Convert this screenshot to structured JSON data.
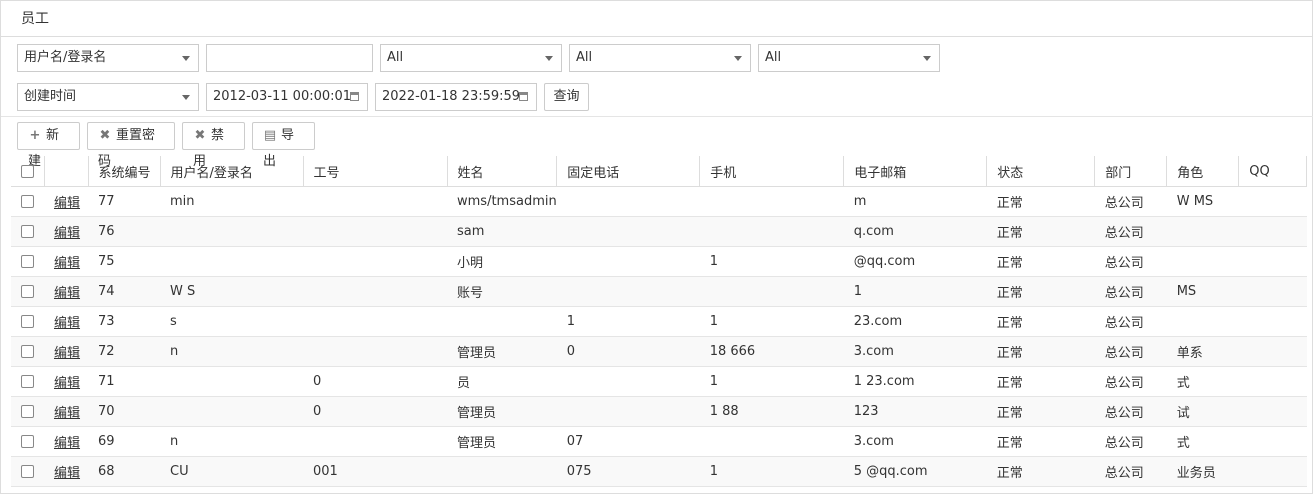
{
  "panel": {
    "title": "员工"
  },
  "filters": {
    "field_select": "用户名/登录名",
    "keyword_value": "",
    "select1": "All",
    "select2": "All",
    "select3": "All",
    "time_field_select": "创建时间",
    "start_time": "2012-03-11 00:00:01",
    "end_time": "2022-01-18 23:59:59",
    "query_label": "查询"
  },
  "toolbar": {
    "new_label": "新建",
    "reset_password_label": "重置密码",
    "disable_label": "禁用",
    "export_label": "导出"
  },
  "table": {
    "edit_label": "编辑",
    "columns": [
      "系统编号",
      "用户名/登录名",
      "工号",
      "姓名",
      "固定电话",
      "手机",
      "电子邮箱",
      "状态",
      "部门",
      "角色",
      "QQ"
    ],
    "rows": [
      {
        "id": "77",
        "username": "min",
        "empno": "",
        "name": "wms/tmsadmin",
        "phone": "",
        "mobile": "",
        "email": "m",
        "status": "正常",
        "dept": "总公司",
        "role": "W MS"
      },
      {
        "id": "76",
        "username": "",
        "empno": "",
        "name": "sam",
        "phone": "",
        "mobile": "",
        "email": "q.com",
        "status": "正常",
        "dept": "总公司",
        "role": ""
      },
      {
        "id": "75",
        "username": "",
        "empno": "",
        "name": "小明",
        "phone": "",
        "mobile": "1",
        "email": "@qq.com",
        "status": "正常",
        "dept": "总公司",
        "role": ""
      },
      {
        "id": "74",
        "username": "W S",
        "empno": "",
        "name": "账号",
        "phone": "",
        "mobile": "",
        "email": "1",
        "status": "正常",
        "dept": "总公司",
        "role": "MS"
      },
      {
        "id": "73",
        "username": "s",
        "empno": "",
        "name": "",
        "phone": "1",
        "mobile": "1",
        "email": "23.com",
        "status": "正常",
        "dept": "总公司",
        "role": ""
      },
      {
        "id": "72",
        "username": "n",
        "empno": "",
        "name": "管理员",
        "phone": "0",
        "mobile": "18 666",
        "email": "3.com",
        "status": "正常",
        "dept": "总公司",
        "role": "单系"
      },
      {
        "id": "71",
        "username": "",
        "empno": "0",
        "name": "员",
        "phone": "",
        "mobile": "1",
        "email": "1 23.com",
        "status": "正常",
        "dept": "总公司",
        "role": "式"
      },
      {
        "id": "70",
        "username": "",
        "empno": "0",
        "name": "管理员",
        "phone": "",
        "mobile": "1 88",
        "email": "123",
        "status": "正常",
        "dept": "总公司",
        "role": "试"
      },
      {
        "id": "69",
        "username": "n",
        "empno": "",
        "name": "管理员",
        "phone": "07",
        "mobile": "",
        "email": "3.com",
        "status": "正常",
        "dept": "总公司",
        "role": "式"
      },
      {
        "id": "68",
        "username": "CU",
        "empno": "001",
        "name": "",
        "phone": "075",
        "mobile": "1",
        "email": "5 @qq.com",
        "status": "正常",
        "dept": "总公司",
        "role": "业务员"
      }
    ]
  }
}
